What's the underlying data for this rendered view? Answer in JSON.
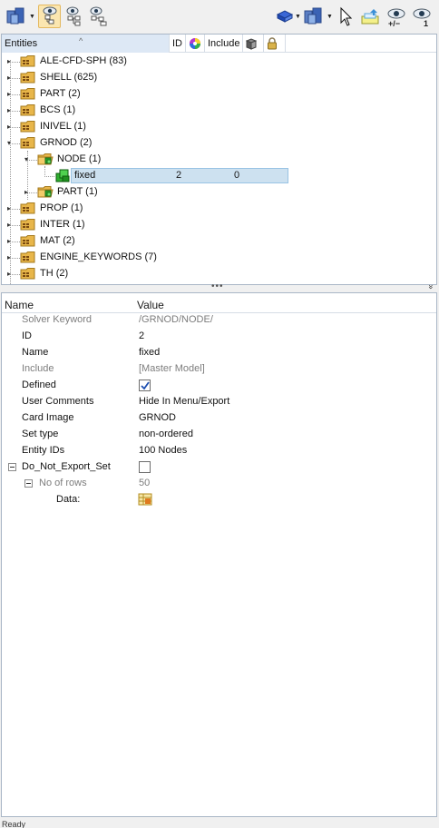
{
  "toolbar": {
    "left_icons": [
      "entity-view-icon",
      "show-hide-tree-icon",
      "tree-options-icon",
      "refresh-icon"
    ],
    "right_icons": [
      "solid-view-icon",
      "entity-display-icon",
      "select-cursor-icon",
      "isolate-icon",
      "show-hide-icon",
      "show-one-icon"
    ],
    "eye_toggle_label": "+/−",
    "eye_one_label": "1"
  },
  "tree": {
    "headers": {
      "entities": "Entities",
      "id": "ID",
      "include": "Include"
    },
    "rows": [
      {
        "name": "ALE-CFD-SPH",
        "count": "(83)"
      },
      {
        "name": "SHELL",
        "count": "(625)"
      },
      {
        "name": "PART",
        "count": "(2)"
      },
      {
        "name": "BCS",
        "count": "(1)"
      },
      {
        "name": "INIVEL",
        "count": "(1)"
      },
      {
        "name": "GRNOD",
        "count": "(2)"
      },
      {
        "name": "NODE",
        "count": "(1)"
      },
      {
        "name": "fixed",
        "count": "",
        "id": "2",
        "include": "0"
      },
      {
        "name": "PART",
        "count": "(1)"
      },
      {
        "name": "PROP",
        "count": "(1)"
      },
      {
        "name": "INTER",
        "count": "(1)"
      },
      {
        "name": "MAT",
        "count": "(2)"
      },
      {
        "name": "ENGINE_KEYWORDS",
        "count": "(7)"
      },
      {
        "name": "TH",
        "count": "(2)"
      }
    ]
  },
  "splitter": {
    "handle": "•••",
    "collapse": "»"
  },
  "props": {
    "headers": {
      "name": "Name",
      "value": "Value"
    },
    "rows": [
      {
        "name": "Solver Keyword",
        "value": "/GRNOD/NODE/"
      },
      {
        "name": "ID",
        "value": "2"
      },
      {
        "name": "Name",
        "value": "fixed"
      },
      {
        "name": "Include",
        "value": "[Master Model]"
      },
      {
        "name": "Defined",
        "value": "checked"
      },
      {
        "name": "User Comments",
        "value": "Hide In Menu/Export"
      },
      {
        "name": "Card Image",
        "value": "GRNOD"
      },
      {
        "name": "Set type",
        "value": "non-ordered"
      },
      {
        "name": "Entity IDs",
        "value": "100 Nodes"
      },
      {
        "name": "Do_Not_Export_Set",
        "value": "unchecked"
      },
      {
        "name": "No of rows",
        "value": "50"
      },
      {
        "name": "Data:",
        "value": ""
      }
    ]
  },
  "status": {
    "text": "Ready"
  },
  "colors": {
    "selection": "#cde1f0",
    "folder": "#e8b64a",
    "node_green": "#2fae2f",
    "toolbar_bg": "#f0f0f0"
  }
}
